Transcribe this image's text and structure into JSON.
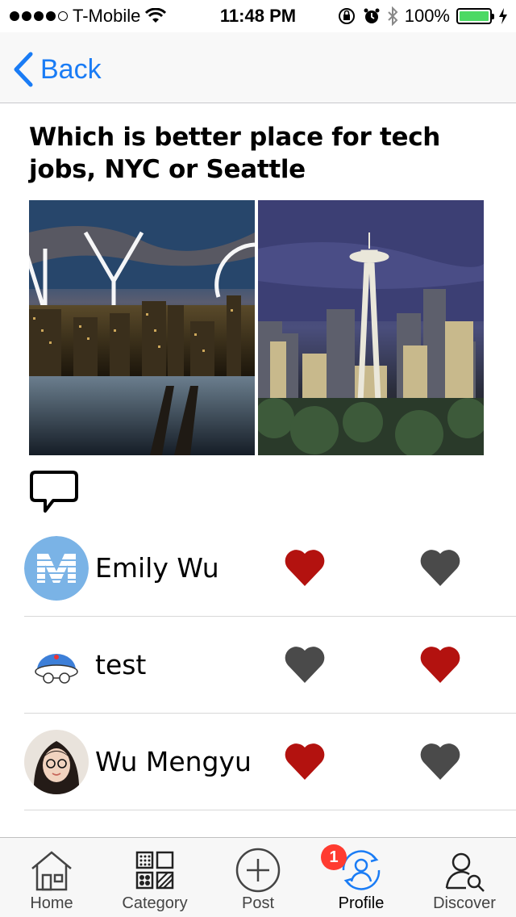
{
  "status_bar": {
    "carrier": "T-Mobile",
    "time": "11:48 PM",
    "battery": "100%",
    "signal_bars_filled": 4,
    "signal_bars_total": 5
  },
  "nav": {
    "back_label": "Back"
  },
  "post": {
    "question": "Which is better place for tech jobs, NYC or Seattle",
    "options": [
      {
        "image": "nyc-skyline"
      },
      {
        "image": "seattle-skyline"
      }
    ]
  },
  "voters": [
    {
      "name": "Emily Wu",
      "avatar": "letter-m-avatar",
      "votes": [
        "liked",
        "not-liked"
      ]
    },
    {
      "name": "test",
      "avatar": "robot-avatar",
      "votes": [
        "not-liked",
        "liked"
      ]
    },
    {
      "name": "Wu Mengyu",
      "avatar": "photo-avatar",
      "votes": [
        "liked",
        "not-liked"
      ]
    }
  ],
  "colors": {
    "accent": "#1a7cf5",
    "heart_liked": "#b3120f",
    "heart_unliked": "#4a4a4a",
    "badge": "#ff3b30"
  },
  "tab_bar": {
    "tabs": [
      {
        "label": "Home",
        "icon": "home-icon"
      },
      {
        "label": "Category",
        "icon": "category-icon"
      },
      {
        "label": "Post",
        "icon": "plus-circle-icon"
      },
      {
        "label": "Profile",
        "icon": "profile-icon",
        "badge": "1"
      },
      {
        "label": "Discover",
        "icon": "discover-icon"
      }
    ]
  }
}
